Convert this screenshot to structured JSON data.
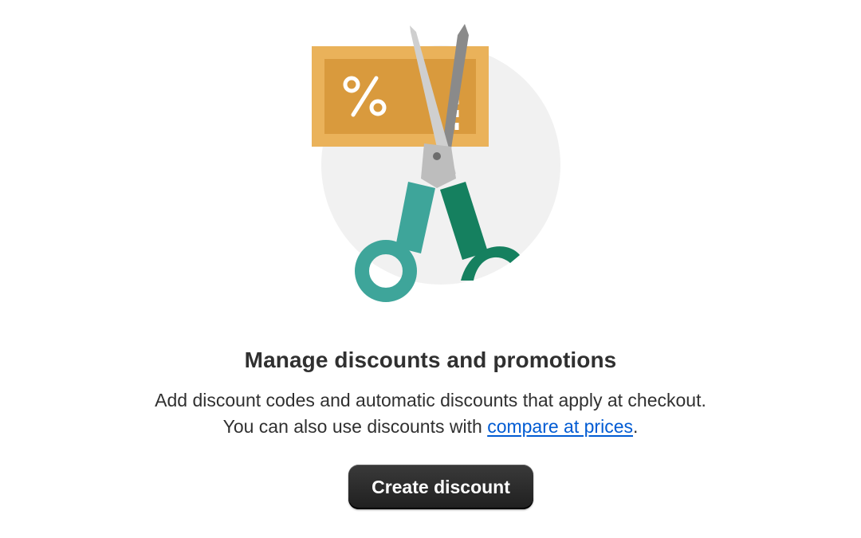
{
  "empty_state": {
    "illustration_icon": "coupon-scissors-icon",
    "heading": "Manage discounts and promotions",
    "description_line1": "Add discount codes and automatic discounts that apply at checkout.",
    "description_line2_prefix": "You can also use discounts with ",
    "description_link": "compare at prices",
    "description_line2_suffix": ".",
    "primary_action_label": "Create discount"
  },
  "colors": {
    "coupon_outer": "#eab25a",
    "coupon_inner": "#d99a3d",
    "handle_left": "#3ea59a",
    "handle_right": "#15805f",
    "backdrop_circle": "#f1f1f1",
    "link": "#005bd3",
    "button": "#303030"
  }
}
